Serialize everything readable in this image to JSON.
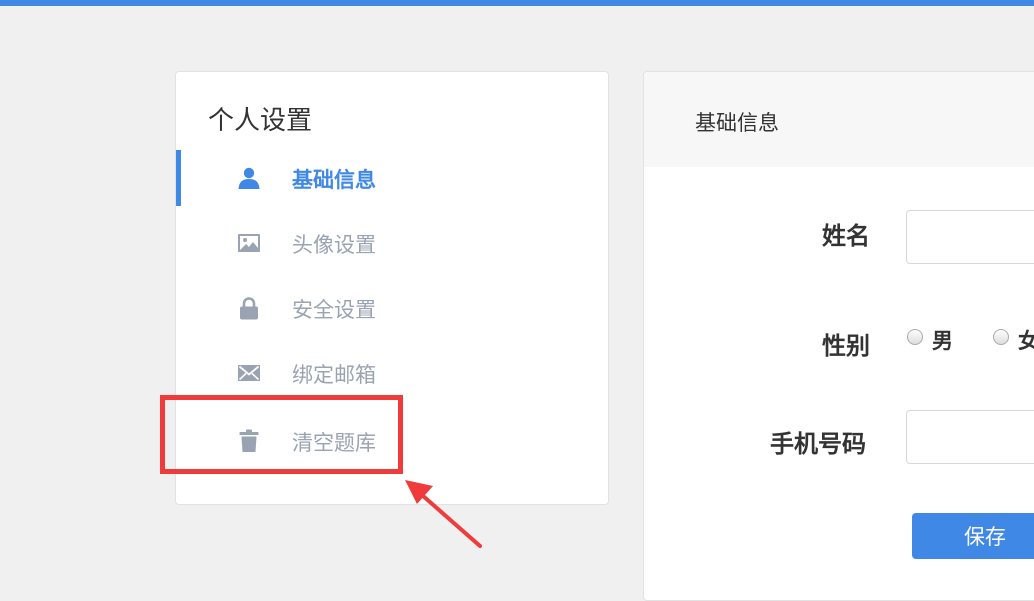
{
  "sidebar": {
    "title": "个人设置",
    "items": [
      {
        "label": "基础信息",
        "icon": "user-icon",
        "active": true
      },
      {
        "label": "头像设置",
        "icon": "image-icon",
        "active": false
      },
      {
        "label": "安全设置",
        "icon": "lock-icon",
        "active": false
      },
      {
        "label": "绑定邮箱",
        "icon": "envelope-icon",
        "active": false
      },
      {
        "label": "清空题库",
        "icon": "trash-icon",
        "active": false
      }
    ]
  },
  "main": {
    "header_title": "基础信息",
    "form": {
      "name_label": "姓名",
      "name_value": "",
      "gender_label": "性别",
      "gender_options": [
        "男",
        "女"
      ],
      "phone_label": "手机号码",
      "phone_value": "",
      "save_label": "保存"
    }
  },
  "colors": {
    "accent": "#3f88e6",
    "annotation": "#ef3b3b",
    "muted_text": "#9aa3b2"
  }
}
